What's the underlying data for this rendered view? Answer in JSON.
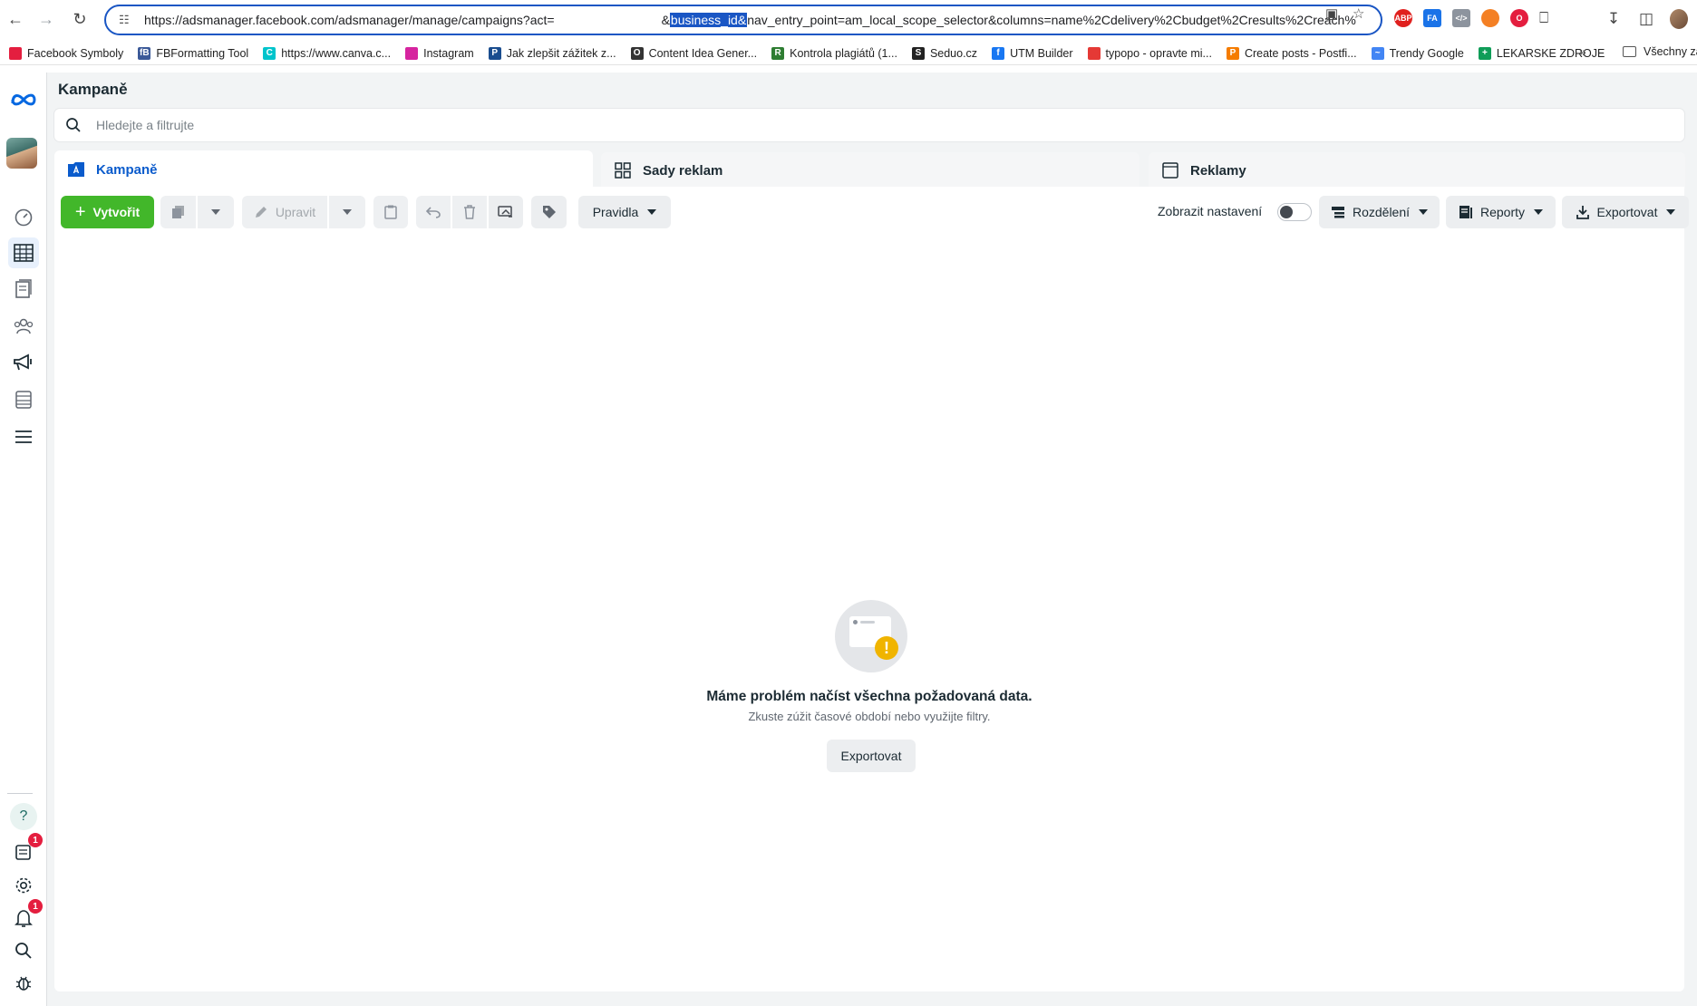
{
  "browser": {
    "url_prefix": "https://adsmanager.facebook.com/adsmanager/manage/campaigns?act=",
    "url_amp": "&",
    "url_selected": "business_id&",
    "url_suffix": "nav_entry_point=am_local_scope_selector&columns=name%2Cdelivery%2Cbudget%2Cresults%2Creach%",
    "extensions": [
      "ABP",
      "FA"
    ]
  },
  "bookmarks": [
    {
      "label": "Facebook Symboly",
      "color": "#e41e3f",
      "glyph": ""
    },
    {
      "label": "FBFormatting Tool",
      "color": "#3b5998",
      "glyph": "fB"
    },
    {
      "label": "https://www.canva.c...",
      "color": "#00c4cc",
      "glyph": "C"
    },
    {
      "label": "Instagram",
      "color": "#d6249f",
      "glyph": ""
    },
    {
      "label": "Jak zlepšit zážitek z...",
      "color": "#1a4d8f",
      "glyph": "P"
    },
    {
      "label": "Content Idea Gener...",
      "color": "#333333",
      "glyph": "O"
    },
    {
      "label": "Kontrola plagiátů (1...",
      "color": "#2e7d32",
      "glyph": "R"
    },
    {
      "label": "Seduo.cz",
      "color": "#222222",
      "glyph": "S"
    },
    {
      "label": "UTM Builder",
      "color": "#1877f2",
      "glyph": "f"
    },
    {
      "label": "typopo - opravte mi...",
      "color": "#e53935",
      "glyph": ""
    },
    {
      "label": "Create posts - Postfi...",
      "color": "#f57c00",
      "glyph": "P"
    },
    {
      "label": "Trendy Google",
      "color": "#4285f4",
      "glyph": "~"
    },
    {
      "label": "LEKARSKE ZDROJE",
      "color": "#0f9d58",
      "glyph": "+"
    }
  ],
  "bookmarks_more": "»",
  "bookmarks_folder": "Všechny zá",
  "sidebar": {
    "badge_notifications": "1",
    "badge_alerts": "1",
    "help": "?"
  },
  "page": {
    "title": "Kampaně",
    "search_placeholder": "Hledejte a filtrujte"
  },
  "tabs": [
    {
      "label": "Kampaně"
    },
    {
      "label": "Sady reklam"
    },
    {
      "label": "Reklamy"
    }
  ],
  "toolbar": {
    "create_label": "Vytvořit",
    "edit_label": "Upravit",
    "rules_label": "Pravidla",
    "show_settings_label": "Zobrazit nastavení",
    "breakdown_label": "Rozdělení",
    "reports_label": "Reporty",
    "export_label": "Exportovat"
  },
  "empty_state": {
    "title": "Máme problém načíst všechna požadovaná data.",
    "subtitle": "Zkuste zúžit časové období nebo využijte filtry.",
    "button": "Exportovat"
  },
  "colors": {
    "primary_green": "#42b72a",
    "active_tab_blue": "#0a5bcc",
    "url_border": "#1a56c4",
    "badge_red": "#e41e3f",
    "warning": "#f0b400"
  }
}
